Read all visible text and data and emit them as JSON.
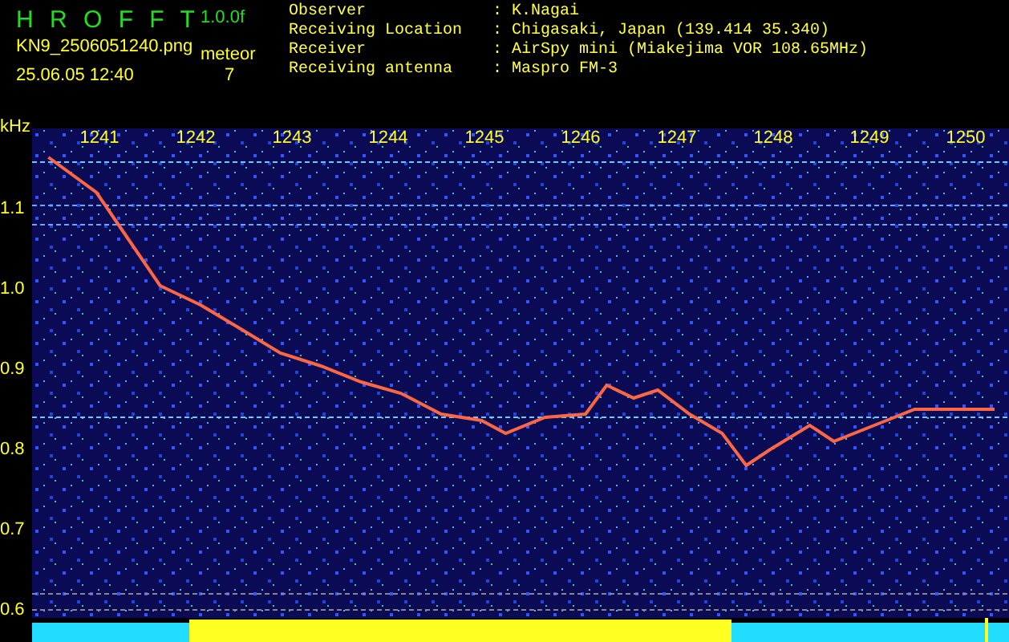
{
  "header": {
    "app_title": "H R O F F T",
    "version": "1.0.0f",
    "file_name": "KN9_2506051240.png",
    "timestamp": "25.06.05 12:40",
    "meteor_label": "meteor",
    "meteor_count": "7"
  },
  "info": [
    {
      "label": "Observer",
      "separator": ":",
      "value": "K.Nagai"
    },
    {
      "label": "Receiving Location",
      "separator": ":",
      "value": "Chigasaki, Japan (139.414 35.340)"
    },
    {
      "label": "Receiver",
      "separator": ":",
      "value": "AirSpy mini (Miakejima VOR 108.65MHz)"
    },
    {
      "label": "Receiving antenna",
      "separator": ":",
      "value": "Maspro FM-3"
    }
  ],
  "spectrogram": {
    "chart_data": {
      "type": "line",
      "ylabel": "kHz",
      "x": [
        1240.47,
        1240.97,
        1241.22,
        1241.63,
        1242.05,
        1242.47,
        1242.88,
        1243.3,
        1243.72,
        1244.13,
        1244.55,
        1244.97,
        1245.22,
        1245.63,
        1246.05,
        1246.27,
        1246.55,
        1246.8,
        1247.13,
        1247.47,
        1247.72,
        1247.97,
        1248.38,
        1248.63,
        1249.05,
        1249.47,
        1249.88,
        1250.3
      ],
      "xlim": [
        1240.3,
        1250.45
      ],
      "ylim": [
        0.59,
        1.2
      ],
      "ref_lines": [
        {
          "axis": "y",
          "value": 1.158,
          "color": "#66ccff"
        },
        {
          "axis": "y",
          "value": 1.104,
          "color": "#66aaff"
        },
        {
          "axis": "y",
          "value": 1.08,
          "color": "#66aaff"
        },
        {
          "axis": "y",
          "value": 0.84,
          "color": "#66ccff"
        },
        {
          "axis": "y",
          "value": 0.62,
          "color": "#888888"
        },
        {
          "axis": "y",
          "value": 0.6,
          "color": "#888888"
        }
      ],
      "series": [
        {
          "color": "#ff6644",
          "values": [
            1.164,
            1.12,
            1.076,
            1.004,
            0.98,
            0.95,
            0.92,
            0.904,
            0.884,
            0.87,
            0.844,
            0.836,
            0.82,
            0.84,
            0.844,
            0.88,
            0.864,
            0.874,
            0.844,
            0.82,
            0.78,
            0.8,
            0.83,
            0.81,
            0.83,
            0.85,
            0.85,
            0.85
          ]
        }
      ],
      "xticks": [
        1241,
        1242,
        1243,
        1244,
        1245,
        1246,
        1247,
        1248,
        1249,
        1250
      ],
      "yticks": [
        {
          "value": 1.1,
          "label": "1.1"
        },
        {
          "value": 1.0,
          "label": "1.0"
        },
        {
          "value": 0.9,
          "label": "0.9"
        },
        {
          "value": 0.8,
          "label": "0.8"
        },
        {
          "value": 0.7,
          "label": "0.7"
        },
        {
          "value": 0.6,
          "label": "0.6"
        }
      ]
    }
  }
}
